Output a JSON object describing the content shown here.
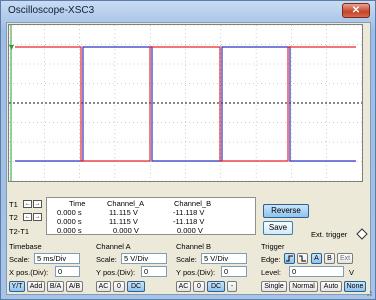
{
  "window": {
    "title": "Oscilloscope-XSC3",
    "close_glyph": "✕"
  },
  "colors": {
    "channel_a": "#e8242c",
    "channel_b": "#2a33c7",
    "trace_ground": "#111111",
    "grid": "#9a9a9a"
  },
  "readout": {
    "headers": [
      "Time",
      "Channel_A",
      "Channel_B"
    ],
    "rows": [
      {
        "label": "T1",
        "time": "0.000 s",
        "a": "11.115 V",
        "b": "-11.118 V"
      },
      {
        "label": "T2",
        "time": "0.000 s",
        "a": "11.115 V",
        "b": "-11.118 V"
      },
      {
        "label": "T2-T1",
        "time": "0.000 s",
        "a": "0.000 V",
        "b": "0.000 V"
      }
    ],
    "left_arrow": "←",
    "right_arrow": "→"
  },
  "buttons": {
    "reverse": "Reverse",
    "save": "Save"
  },
  "ext_trigger_label": "Ext. trigger",
  "timebase": {
    "title": "Timebase",
    "scale_label": "Scale:",
    "scale": "5 ms/Div",
    "xpos_label": "X pos.(Div):",
    "xpos": "0",
    "modes": [
      "Y/T",
      "Add",
      "B/A",
      "A/B"
    ]
  },
  "channel_a": {
    "title": "Channel A",
    "scale_label": "Scale:",
    "scale": "5 V/Div",
    "ypos_label": "Y pos.(Div):",
    "ypos": "0",
    "coupling": [
      "AC",
      "0",
      "DC"
    ]
  },
  "channel_b": {
    "title": "Channel B",
    "scale_label": "Scale:",
    "scale": "5 V/Div",
    "ypos_label": "Y pos.(Div):",
    "ypos": "0",
    "coupling": [
      "AC",
      "0",
      "DC",
      "-"
    ]
  },
  "trigger": {
    "title": "Trigger",
    "edge_label": "Edge:",
    "edge_rising": "ʃ",
    "edge_falling": "⫘",
    "sources": [
      "A",
      "B",
      "Ext"
    ],
    "level_label": "Level:",
    "level": "0",
    "level_unit": "V",
    "modes": [
      "Single",
      "Normal",
      "Auto",
      "None"
    ]
  }
}
